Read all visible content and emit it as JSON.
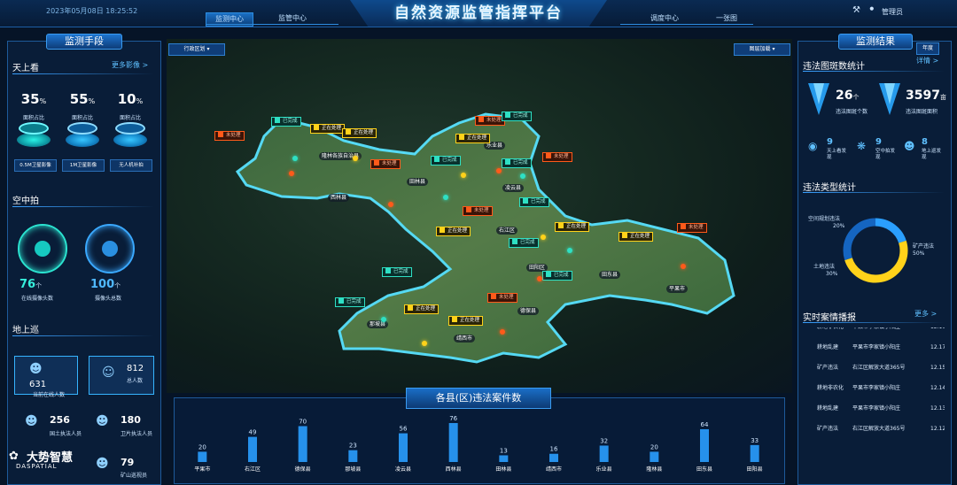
{
  "header": {
    "datetime": "2023年05月08日 18:25:52",
    "title": "自然资源监管指挥平台",
    "nav_left": [
      "监测中心",
      "监管中心"
    ],
    "nav_right": [
      "调度中心",
      "一张图"
    ],
    "user": "管理员",
    "accent": "#2d8ce0"
  },
  "map": {
    "district_dropdown": "行政区划",
    "layer_dropdown": "图层加载",
    "counties": [
      "隆林各族自治县",
      "西林县",
      "田林县",
      "乐业县",
      "凌云县",
      "右江区",
      "田阳区",
      "田东县",
      "平果市",
      "德保县",
      "那坡县",
      "靖西市"
    ],
    "statuses": {
      "done": "已完成",
      "processing": "正在处理",
      "pending": "未处理"
    }
  },
  "left": {
    "panel_title": "监测手段",
    "sky": {
      "title": "天上看",
      "more": "更多影像 >",
      "items": [
        {
          "pct": "35",
          "unit": "%",
          "label": "面积占比",
          "chip": "0.5M卫星影像"
        },
        {
          "pct": "55",
          "unit": "%",
          "label": "面积占比",
          "chip": "1M卫星影像"
        },
        {
          "pct": "10",
          "unit": "%",
          "label": "面积占比",
          "chip": "无人机补拍"
        }
      ]
    },
    "air": {
      "title": "空中拍",
      "items": [
        {
          "num": "76",
          "unit": "个",
          "label": "在线摄像头数"
        },
        {
          "num": "100",
          "unit": "个",
          "label": "摄像头总数"
        }
      ]
    },
    "ground": {
      "title": "地上巡",
      "boxes": [
        {
          "num": "631",
          "label": "当前在线人数"
        },
        {
          "num": "812",
          "label": "总人数"
        }
      ],
      "people": [
        {
          "num": "256",
          "label": "国土执法人员"
        },
        {
          "num": "180",
          "label": "卫片执法人员"
        },
        {
          "num": "79",
          "label": "矿山巡视员"
        }
      ]
    },
    "logo_cn": "大势智慧",
    "logo_en": "DASPATIAL"
  },
  "right": {
    "panel_title": "监测结果",
    "year_badge": "年度",
    "illegal_stats": {
      "title": "违法图斑数统计",
      "detail": "详情 >",
      "count": "26",
      "count_unit": "个",
      "count_label": "违法图斑个数",
      "area": "3597",
      "area_unit": "亩",
      "area_label": "违法图斑面积",
      "sources": [
        {
          "num": "9",
          "label": "天上看发现"
        },
        {
          "num": "9",
          "label": "空中拍发现"
        },
        {
          "num": "8",
          "label": "地上巡发现"
        }
      ]
    },
    "type_stats": {
      "title": "违法类型统计",
      "items": [
        {
          "name": "空间规划违法",
          "pct": "20%",
          "value": 20,
          "color": "#2a9fff"
        },
        {
          "name": "矿产违法",
          "pct": "50%",
          "value": 50,
          "color": "#ffd21a"
        },
        {
          "name": "土地违法",
          "pct": "30%",
          "value": 30,
          "color": "#1565c0"
        }
      ]
    },
    "cases": {
      "title": "实时案情播报",
      "more": "更多 >",
      "rows": [
        {
          "type": "耕地非农化",
          "addr": "平果市李家镇小阳庄",
          "date": "12.16"
        },
        {
          "type": "耕地乱建",
          "addr": "平果市李家镇小阳庄",
          "date": "12.17"
        },
        {
          "type": "矿产违法",
          "addr": "右江区解放大道365号",
          "date": "12.15"
        },
        {
          "type": "耕地非农化",
          "addr": "平果市李家镇小阳庄",
          "date": "12.14"
        },
        {
          "type": "耕地乱建",
          "addr": "平果市李家镇小阳庄",
          "date": "12.13"
        },
        {
          "type": "矿产违法",
          "addr": "右江区解放大道365号",
          "date": "12.12"
        }
      ]
    }
  },
  "chart_data": {
    "type": "bar",
    "title": "各县(区)违法案件数",
    "categories": [
      "平果市",
      "右江区",
      "德保县",
      "那坡县",
      "凌云县",
      "西林县",
      "田林县",
      "靖西市",
      "乐业县",
      "隆林县",
      "田东县",
      "田阳县"
    ],
    "values": [
      20,
      49,
      70,
      23,
      56,
      76,
      13,
      16,
      32,
      20,
      64,
      33
    ],
    "ylim": [
      0,
      80
    ],
    "grid": false,
    "color": "#2a9fff"
  }
}
